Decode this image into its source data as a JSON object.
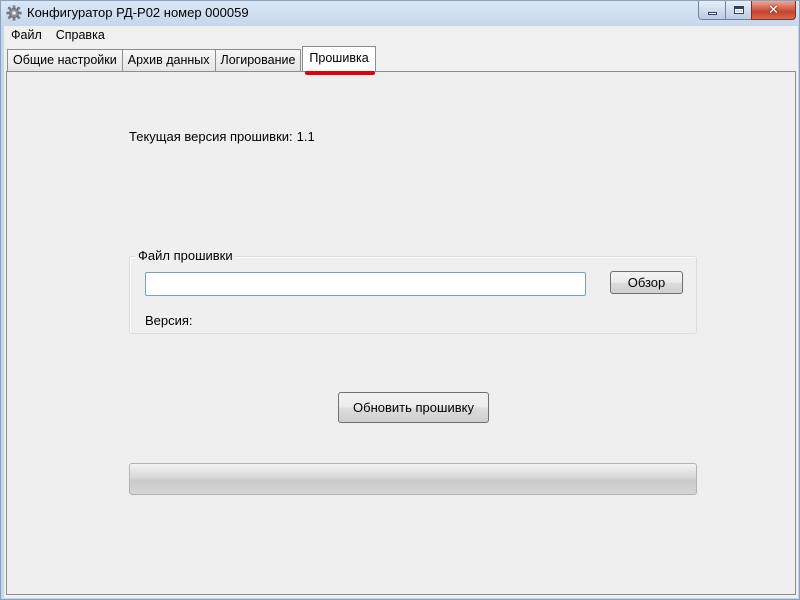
{
  "window": {
    "title": "Конфигуратор РД-Р02 номер 000059",
    "controls": {
      "minimize": "minimize-icon",
      "maximize": "maximize-icon",
      "close": "close-icon"
    }
  },
  "menu": [
    "Файл",
    "Справка"
  ],
  "tabs": [
    {
      "label": "Общие настройки",
      "active": false
    },
    {
      "label": "Архив данных",
      "active": false
    },
    {
      "label": "Логирование",
      "active": false
    },
    {
      "label": "Прошивка",
      "active": true
    }
  ],
  "firmware": {
    "current_version_label": "Текущая версия прошивки:",
    "current_version_value": "1.1",
    "file_group_title": "Файл прошивки",
    "file_path_value": "",
    "browse_label": "Обзор",
    "version_label": "Версия:",
    "update_label": "Обновить прошивку",
    "progress": 0
  },
  "colors": {
    "active_tab_highlight": "#e3000b",
    "input_border": "#7fa3c6",
    "window_frame": "#c5d6ec"
  }
}
